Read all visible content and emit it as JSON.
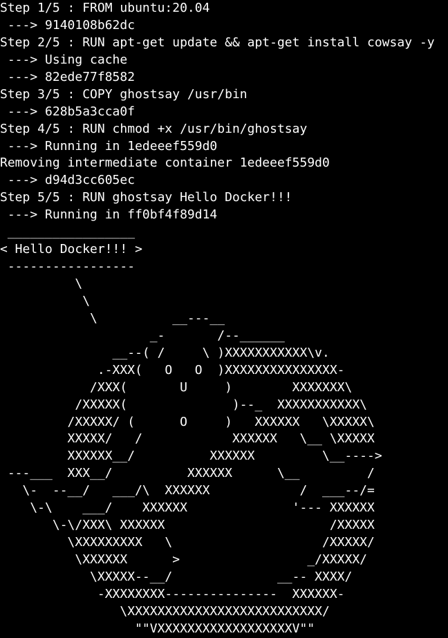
{
  "colors": {
    "background": "#000000",
    "foreground": "#ffffff"
  },
  "terminal": {
    "lines": [
      "Step 1/5 : FROM ubuntu:20.04",
      " ---> 9140108b62dc",
      "Step 2/5 : RUN apt-get update && apt-get install cowsay -y",
      " ---> Using cache",
      " ---> 82ede77f8582",
      "Step 3/5 : COPY ghostsay /usr/bin",
      " ---> 628b5a3cca0f",
      "Step 4/5 : RUN chmod +x /usr/bin/ghostsay",
      " ---> Running in 1edeeef559d0",
      "Removing intermediate container 1edeeef559d0",
      " ---> d94d3cc605ec",
      "Step 5/5 : RUN ghostsay Hello Docker!!!",
      " ---> Running in ff0bf4f89d14",
      " _________________",
      "< Hello Docker!!! >",
      " -----------------",
      "          \\",
      "           \\",
      "            \\          __---__",
      "                    _-       /--______",
      "               __--( /     \\ )XXXXXXXXXXX\\v.",
      "             .-XXX(   O   O  )XXXXXXXXXXXXXXX-",
      "            /XXX(       U     )        XXXXXXX\\",
      "          /XXXXX(              )--_  XXXXXXXXXXX\\",
      "         /XXXXX/ (      O     )   XXXXXX   \\XXXXX\\",
      "         XXXXX/   /            XXXXXX   \\__ \\XXXXX",
      "         XXXXXX__/          XXXXXX         \\__---->",
      " ---___  XXX__/          XXXXXX      \\__         /",
      "   \\-  --__/   ___/\\  XXXXXX            /  ___--/=",
      "    \\-\\    ___/    XXXXXX              '--- XXXXXX",
      "       \\-\\/XXX\\ XXXXXX                      /XXXXX",
      "         \\XXXXXXXXX   \\                    /XXXXX/",
      "          \\XXXXXX      >                 _/XXXXX/",
      "            \\XXXXX--__/              __-- XXXX/",
      "             -XXXXXXXX---------------  XXXXXX-",
      "                \\XXXXXXXXXXXXXXXXXXXXXXXXXX/",
      "                  \"\"VXXXXXXXXXXXXXXXXXXV\"\""
    ]
  }
}
